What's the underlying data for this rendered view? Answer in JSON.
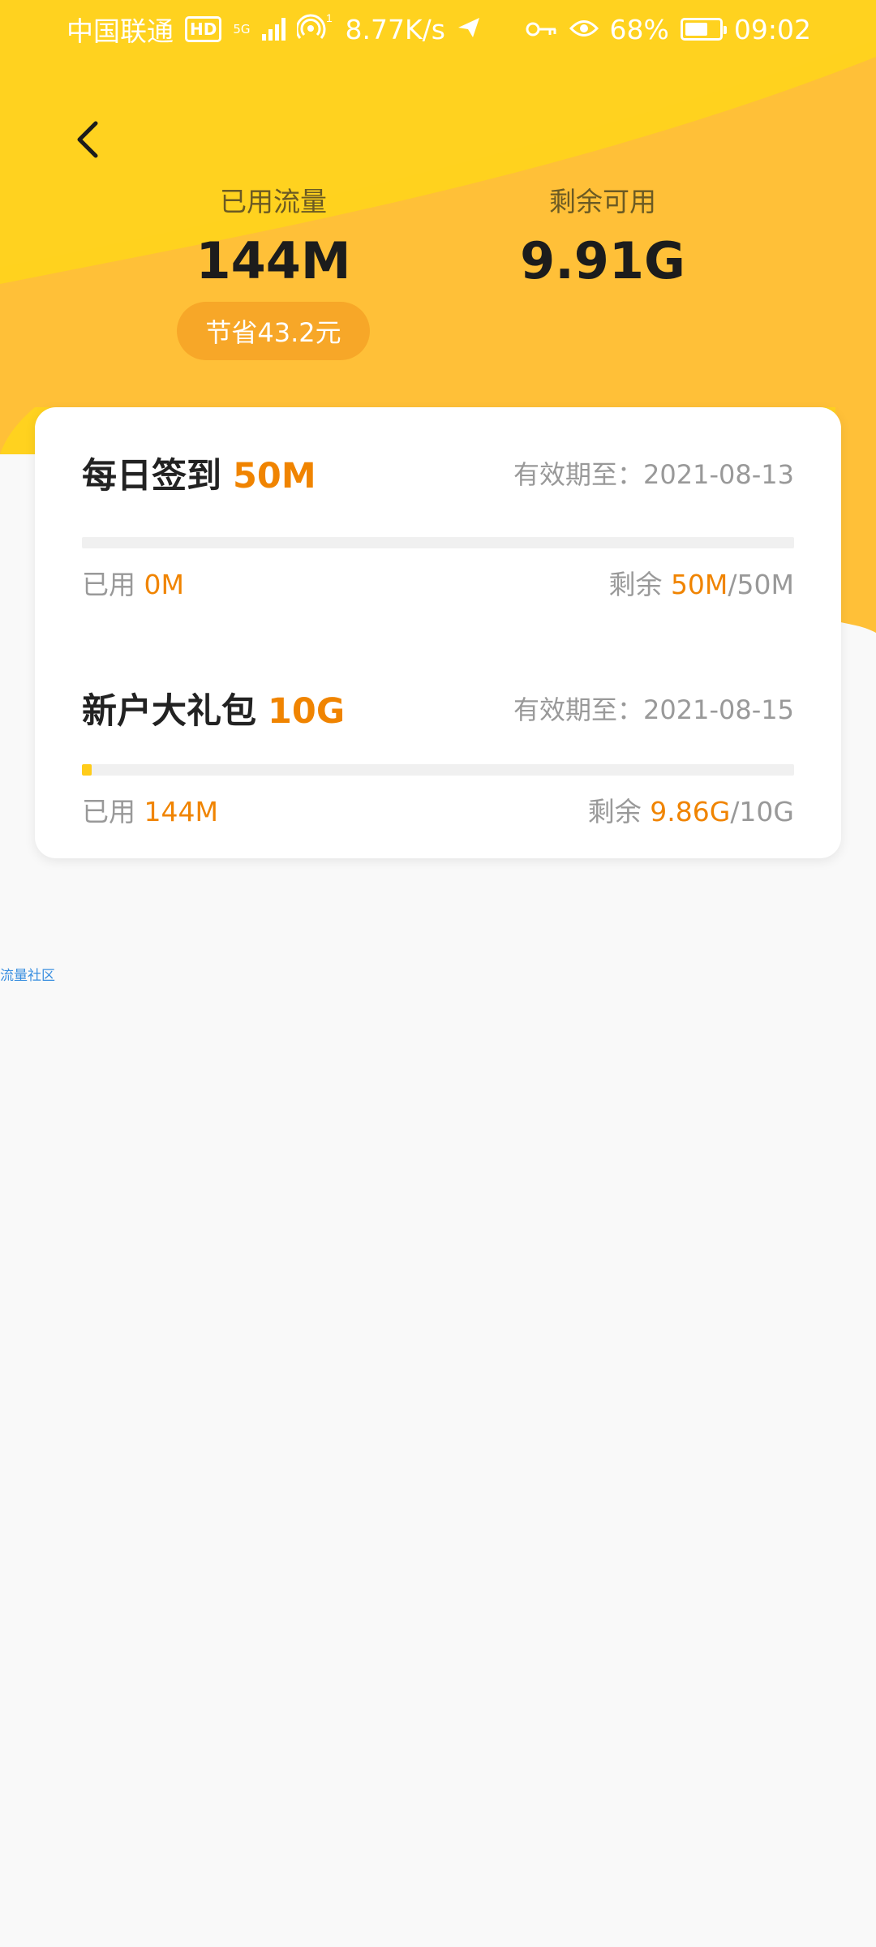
{
  "colors": {
    "header_yellow": "#FFD21F",
    "accent_orange": "#F08400",
    "pill_orange": "#F7A728",
    "progress_yellow": "#FFCC1A"
  },
  "status_bar": {
    "carrier": "中国联通",
    "hd": "HD",
    "network": "5G",
    "hotspot_count": "1",
    "speed": "8.77K/s",
    "battery_percent": "68%",
    "battery_level": 0.68,
    "time": "09:02",
    "icons": [
      "hd-icon",
      "signal-icon",
      "hotspot-icon",
      "send-icon",
      "key-icon",
      "eye-icon",
      "battery-icon"
    ]
  },
  "header": {
    "back_icon": "chevron-left-icon",
    "used_label": "已用流量",
    "used_value": "144M",
    "remaining_label": "剩余可用",
    "remaining_value": "9.91G",
    "savings": "节省43.2元"
  },
  "packages": [
    {
      "title": "每日签到",
      "amount": "50M",
      "expiry_label": "有效期至：",
      "expiry_date": "2021-08-13",
      "used_label": "已用",
      "used": "0M",
      "remaining_label": "剩余",
      "remaining": "50M",
      "total": "/50M",
      "progress": 0.0
    },
    {
      "title": "新户大礼包",
      "amount": "10G",
      "expiry_label": "有效期至：",
      "expiry_date": "2021-08-15",
      "used_label": "已用",
      "used": "144M",
      "remaining_label": "剩余",
      "remaining": "9.86G",
      "total": "/10G",
      "progress": 0.014
    }
  ],
  "watermark": "流量社区"
}
